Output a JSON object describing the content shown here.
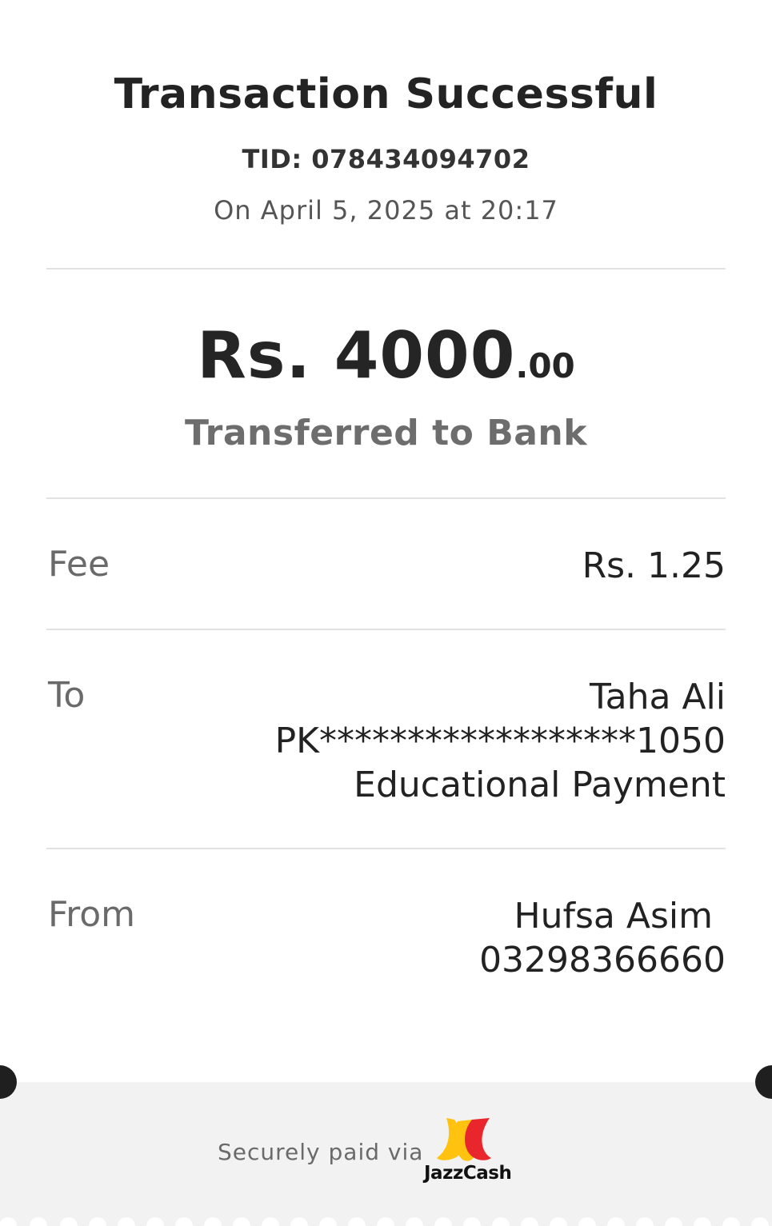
{
  "header": {
    "title": "Transaction Successful",
    "tid": "TID: 078434094702",
    "datetime": "On April 5, 2025 at 20:17"
  },
  "amount": {
    "main": "Rs. 4000",
    "decimals": ".00",
    "type": "Transferred to Bank"
  },
  "fee": {
    "label": "Fee",
    "value": "Rs. 1.25"
  },
  "to": {
    "label": "To",
    "name": "Taha Ali",
    "account": "PK******************1050",
    "purpose": "Educational Payment"
  },
  "from": {
    "label": "From",
    "name": "Hufsa Asim",
    "phone": "03298366660"
  },
  "footer": {
    "secure_text": "Securely paid via",
    "logo_text": "JazzCash",
    "logo_icon": "jazzcash-logo-icon"
  },
  "colors": {
    "logo_yellow": "#FFC20E",
    "logo_red": "#E8262B",
    "footer_bg": "#F2F2F2"
  }
}
